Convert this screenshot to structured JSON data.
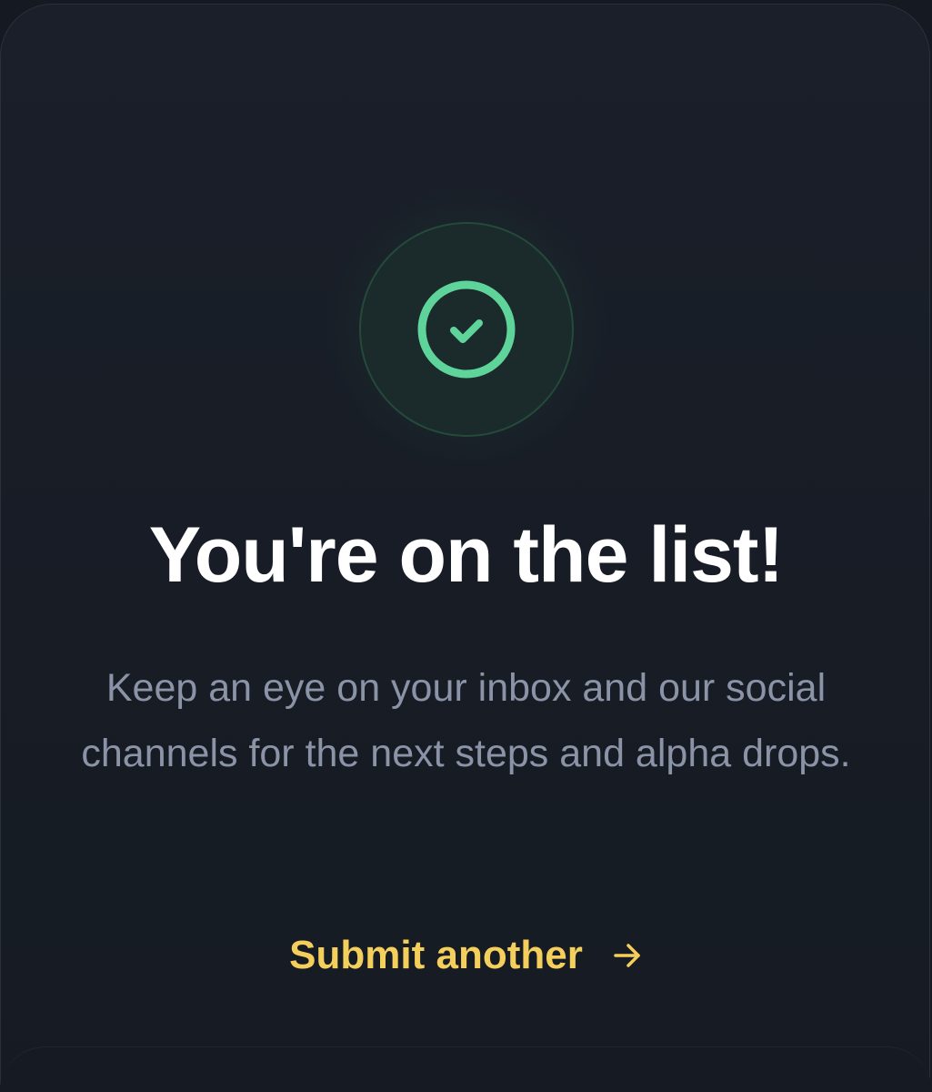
{
  "success": {
    "icon": "check-circle-icon",
    "accent_color": "#5ed39a"
  },
  "title": "You're on the list!",
  "message": "Keep an eye on your inbox and our social channels for the next steps and alpha drops.",
  "cta": {
    "label": "Submit another",
    "icon": "arrow-right-icon",
    "color": "#f5cf5b"
  }
}
